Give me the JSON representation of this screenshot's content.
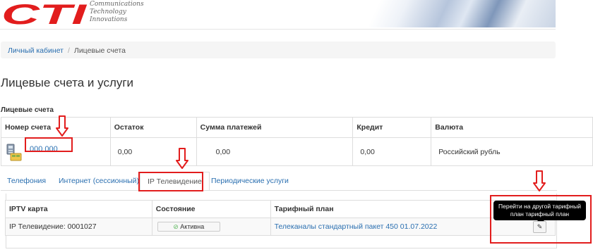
{
  "header": {
    "logo_text": "CTI",
    "tagline": [
      "Communications",
      "Technology",
      "Innovations"
    ]
  },
  "breadcrumb": {
    "home": "Личный кабинет",
    "separator": "/",
    "current": "Лицевые счета"
  },
  "page_title": "Лицевые счета и услуги",
  "accounts_section": {
    "label": "Лицевые счета",
    "columns": [
      "Номер счета",
      "Остаток",
      "Сумма платежей",
      "Кредит",
      "Валюта"
    ],
    "rows": [
      {
        "number": "000 000",
        "balance": "0,00",
        "payments": "0,00",
        "credit": "0,00",
        "currency": "Российский рубль"
      }
    ]
  },
  "tabs": [
    {
      "label": "Телефония",
      "active": false
    },
    {
      "label": "Интернет (сессионный)",
      "active": false
    },
    {
      "label": "IP Телевидение",
      "active": true
    },
    {
      "label": "Периодические услуги",
      "active": false
    }
  ],
  "iptv": {
    "columns": [
      "IPTV карта",
      "Состояние",
      "Тарифный план"
    ],
    "rows": [
      {
        "card": "IP Телевидение: 0001027",
        "status": "Активна",
        "plan": "Телеканалы стандартный пакет 450 01.07.2022"
      }
    ],
    "tooltip": [
      "Перейти на другой тарифный",
      "план тарифный план"
    ]
  },
  "colors": {
    "brand_red": "#e21d1d",
    "link_blue": "#2a6fb0",
    "active_green": "#5cb85c"
  },
  "icons": {
    "account": "account-card-icon",
    "status_ok": "check-circle-icon",
    "edit": "edit-icon",
    "annotation": "down-arrow-icon"
  }
}
